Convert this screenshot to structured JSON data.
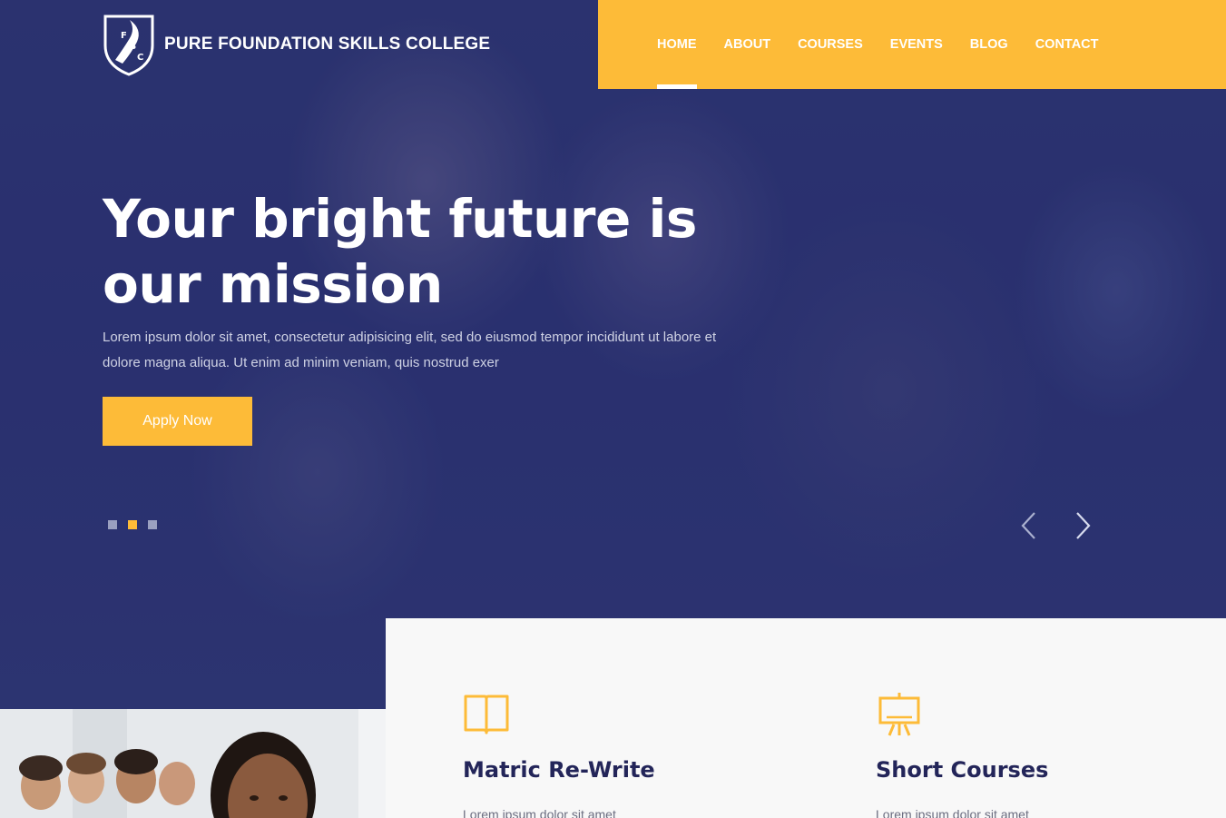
{
  "brand": {
    "name": "PURE FOUNDATION SKILLS COLLEGE",
    "crest_letters": [
      "F",
      "S",
      "C"
    ],
    "crest_caption": "PURE FOUNDATION SKILLS COLLEGE"
  },
  "nav": {
    "items": [
      {
        "label": "HOME",
        "active": true
      },
      {
        "label": "ABOUT",
        "active": false
      },
      {
        "label": "COURSES",
        "active": false
      },
      {
        "label": "EVENTS",
        "active": false
      },
      {
        "label": "BLOG",
        "active": false
      },
      {
        "label": "CONTACT",
        "active": false
      }
    ]
  },
  "hero": {
    "title_line1": "Your bright future is",
    "title_line2": "our mission",
    "description": "Lorem ipsum dolor sit amet, consectetur adipisicing elit, sed do eiusmod tempor incididunt ut labore et dolore magna aliqua. Ut enim ad minim veniam, quis nostrud exer",
    "cta_label": "Apply Now",
    "slides_total": 3,
    "active_slide": 2
  },
  "features": [
    {
      "icon": "book-icon",
      "title": "Matric Re-Write",
      "text": "Lorem ipsum dolor sit amet"
    },
    {
      "icon": "presentation-board-icon",
      "title": "Short Courses",
      "text": "Lorem ipsum dolor sit amet"
    }
  ],
  "colors": {
    "accent": "#fdbb38",
    "hero_overlay": "#2d3470",
    "heading_dark": "#232559"
  }
}
